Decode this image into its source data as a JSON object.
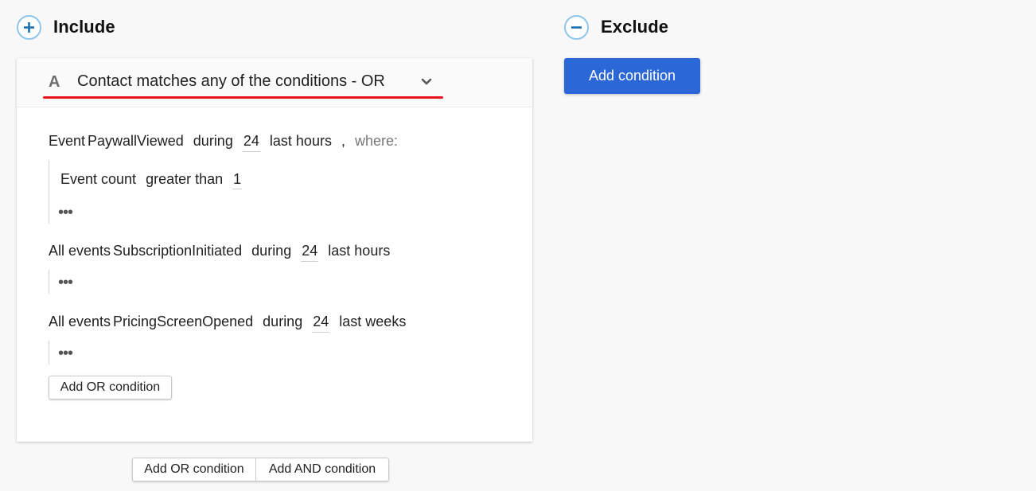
{
  "include": {
    "title": "Include",
    "icon": "plus-circle-icon"
  },
  "exclude": {
    "title": "Exclude",
    "icon": "minus-circle-icon",
    "add_condition_label": "Add condition"
  },
  "group": {
    "letter": "A",
    "title": "Contact matches any of the conditions - OR",
    "highlight_color": "#e8141c",
    "conditions": [
      {
        "kind": "Event",
        "event": "PaywallViewed",
        "during_label": "during",
        "amount": "24",
        "unit": "last hours",
        "comma": ",",
        "where_label": "where:",
        "sub_condition": {
          "field": "Event count",
          "operator": "greater than",
          "value": "1"
        },
        "more": "•••"
      },
      {
        "kind": "All events",
        "event": "SubscriptionInitiated",
        "during_label": "during",
        "amount": "24",
        "unit": "last hours",
        "more": "•••"
      },
      {
        "kind": "All events",
        "event": "PricingScreenOpened",
        "during_label": "during",
        "amount": "24",
        "unit": "last weeks",
        "more": "•••"
      }
    ],
    "add_or_label": "Add OR condition"
  },
  "footer": {
    "add_or_label": "Add OR condition",
    "add_and_label": "Add AND condition"
  },
  "colors": {
    "primary_button": "#2b67d6",
    "icon_ring": "#8ec6ea",
    "icon_glyph": "#1d6fb5"
  }
}
